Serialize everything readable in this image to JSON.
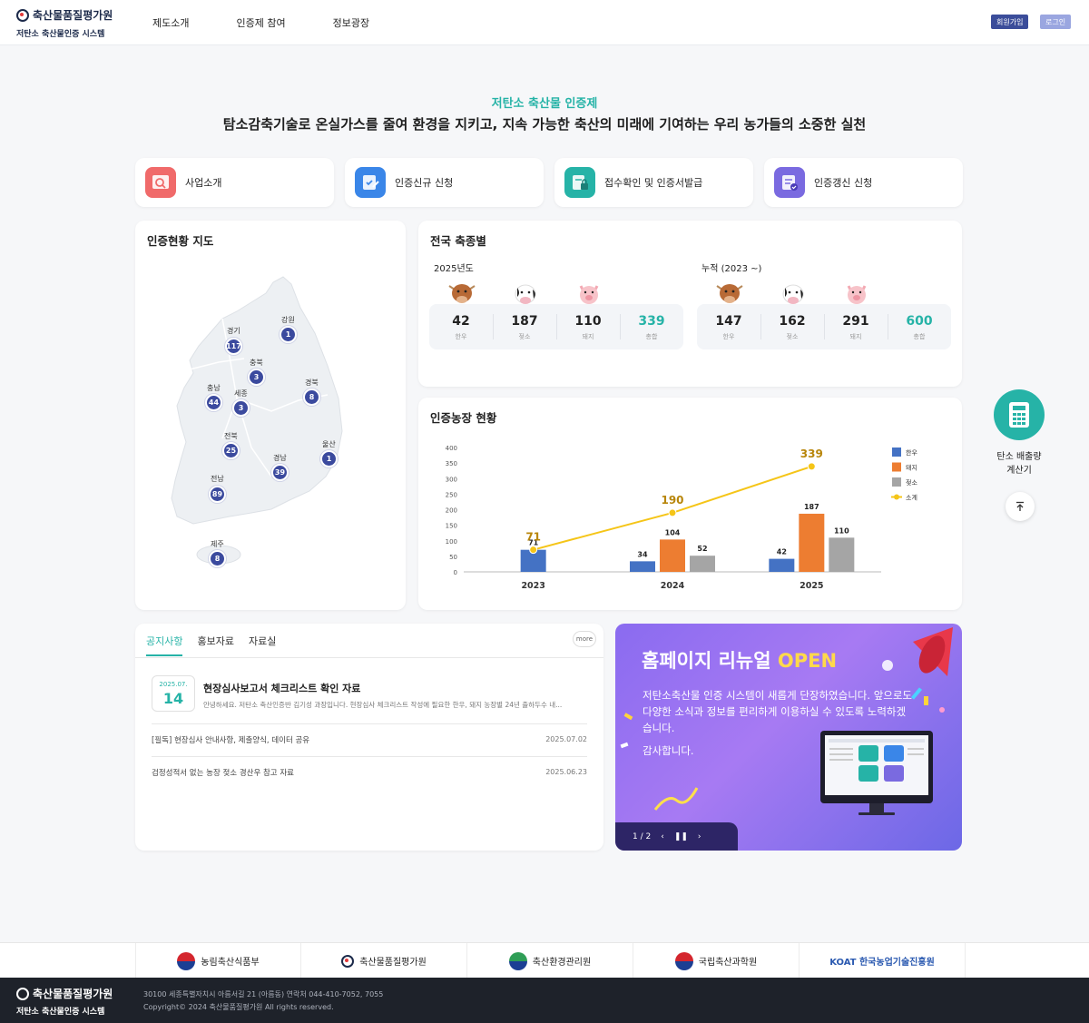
{
  "header": {
    "logo_org": "축산물품질평가원",
    "logo_system": "저탄소 축산물인증 시스템",
    "nav": [
      "제도소개",
      "인증제 참여",
      "정보광장"
    ],
    "join_label": "회원가입",
    "login_label": "로그인"
  },
  "hero": {
    "kicker": "저탄소 축산물 인증제",
    "title": "탐소감축기술로 온실가스를 줄여 환경을 지키고, 지속 가능한 축산의 미래에 기여하는 우리 농가들의 소중한 실천"
  },
  "quick_links": [
    {
      "label": "사업소개",
      "icon": "search-document-icon",
      "color": "#f06a6a"
    },
    {
      "label": "인증신규 신청",
      "icon": "edit-form-icon",
      "color": "#3a86e8"
    },
    {
      "label": "접수확인 및 인증서발급",
      "icon": "lock-document-icon",
      "color": "#26b3a7"
    },
    {
      "label": "인증갱신 신청",
      "icon": "checklist-icon",
      "color": "#7a6ae0"
    }
  ],
  "map": {
    "title": "인증현황 지도",
    "regions": [
      {
        "name": "경기",
        "count": "117"
      },
      {
        "name": "강원",
        "count": "1"
      },
      {
        "name": "충북",
        "count": "3"
      },
      {
        "name": "충남",
        "count": "44"
      },
      {
        "name": "세종",
        "count": "3"
      },
      {
        "name": "경북",
        "count": "8"
      },
      {
        "name": "전북",
        "count": "25"
      },
      {
        "name": "경남",
        "count": "39"
      },
      {
        "name": "울산",
        "count": "1"
      },
      {
        "name": "전남",
        "count": "89"
      },
      {
        "name": "제주",
        "count": "8"
      }
    ]
  },
  "livestock": {
    "title": "전국 축종별",
    "groups": [
      {
        "label": "2025년도",
        "stats": [
          {
            "value": "42",
            "label": "한우"
          },
          {
            "value": "187",
            "label": "젖소"
          },
          {
            "value": "110",
            "label": "돼지"
          },
          {
            "value": "339",
            "label": "총합"
          }
        ]
      },
      {
        "label": "누적 (2023 ~)",
        "stats": [
          {
            "value": "147",
            "label": "한우"
          },
          {
            "value": "162",
            "label": "젖소"
          },
          {
            "value": "291",
            "label": "돼지"
          },
          {
            "value": "600",
            "label": "총합"
          }
        ]
      }
    ]
  },
  "farm_chart": {
    "title": "인증농장 현황"
  },
  "chart_data": {
    "type": "bar",
    "categories": [
      "2023",
      "2024",
      "2025"
    ],
    "ylim": [
      0,
      400
    ],
    "yticks": [
      0,
      50,
      100,
      150,
      200,
      250,
      300,
      350,
      400
    ],
    "series": [
      {
        "name": "한우",
        "type": "bar",
        "color": "#4472c4",
        "values": [
          71,
          34,
          42
        ]
      },
      {
        "name": "돼지",
        "type": "bar",
        "color": "#ed7d31",
        "values": [
          null,
          104,
          187
        ]
      },
      {
        "name": "젖소",
        "type": "bar",
        "color": "#a5a5a5",
        "values": [
          null,
          52,
          110
        ]
      },
      {
        "name": "소계",
        "type": "line",
        "color": "#f5c518",
        "values": [
          71,
          190,
          339
        ]
      }
    ],
    "legend": "right"
  },
  "side": {
    "calc_label_1": "탄소 배출량",
    "calc_label_2": "계산기"
  },
  "notice": {
    "tabs": [
      "공지사항",
      "홍보자료",
      "자료실"
    ],
    "more_label": "more",
    "featured": {
      "date_ym": "2025.07.",
      "date_d": "14",
      "title": "현장심사보고서 체크리스트 확인 자료",
      "summary": "안녕하세요. 저탄소 축산인증반 김기성 과장입니다. 현장심사 체크리스트 작성에 필요한 한우, 돼지 농장별 24년 출하두수 내..."
    },
    "items": [
      {
        "title": "[필독] 현장심사 안내사항, 제출양식, 데이터 공유",
        "date": "2025.07.02"
      },
      {
        "title": "검정성적서 없는 농장 젖소 경산우 참고 자료",
        "date": "2025.06.23"
      }
    ]
  },
  "banner": {
    "title_main": "홈페이지 리뉴얼 ",
    "title_accent": "OPEN",
    "body": "저탄소축산물 인증 시스템이 새롭게 단장하였습니다. 앞으로도 다양한 소식과 정보를 편리하게 이용하실 수 있도록 노력하겠습니다.",
    "thanks": "감사합니다.",
    "pager": "1 / 2"
  },
  "partners": [
    "농림축산식품부",
    "축산물품질평가원",
    "축산환경관리원",
    "국립축산과학원",
    "KOAT 한국농업기술진흥원"
  ],
  "footer": {
    "logo_org": "축산물품질평가원",
    "logo_system": "저탄소 축산물인증 시스템",
    "address": "30100 세종특별자치시 아름서길 21 (아름동) 연락처 044-410-7052, 7055",
    "copyright": "Copyright© 2024 축산물품질평가원 All rights reserved."
  }
}
